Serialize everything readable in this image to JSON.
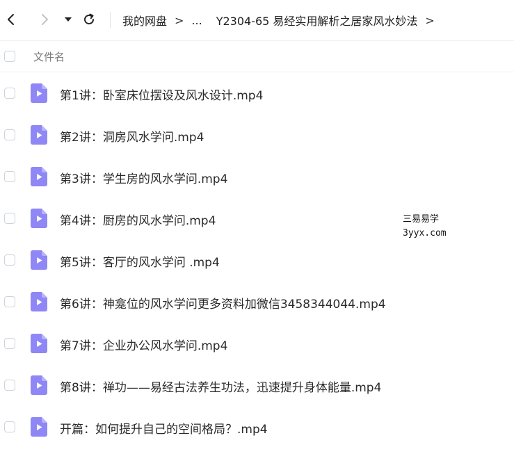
{
  "toolbar": {
    "breadcrumb": [
      "我的网盘",
      "...",
      "Y2304-65 易经实用解析之居家风水妙法"
    ],
    "crumb_separator": ">"
  },
  "list": {
    "column_name_label": "文件名",
    "files": [
      {
        "name": "第1讲：卧室床位摆设及风水设计.mp4"
      },
      {
        "name": "第2讲：洞房风水学问.mp4"
      },
      {
        "name": "第3讲：学生房的风水学问.mp4"
      },
      {
        "name": "第4讲：厨房的风水学问.mp4"
      },
      {
        "name": "第5讲：客厅的风水学问 .mp4"
      },
      {
        "name": "第6讲：神龛位的风水学问更多资料加微信3458344044.mp4"
      },
      {
        "name": "第7讲：企业办公风水学问.mp4"
      },
      {
        "name": "第8讲：禅功——易经古法养生功法，迅速提升身体能量.mp4"
      },
      {
        "name": "开篇：如何提升自己的空间格局？.mp4"
      }
    ]
  },
  "watermark": {
    "line1": "三易易学",
    "line2": "3yyx.com"
  },
  "colors": {
    "file_icon": "#8f87f5",
    "file_icon_fold": "#b9b3fa"
  }
}
